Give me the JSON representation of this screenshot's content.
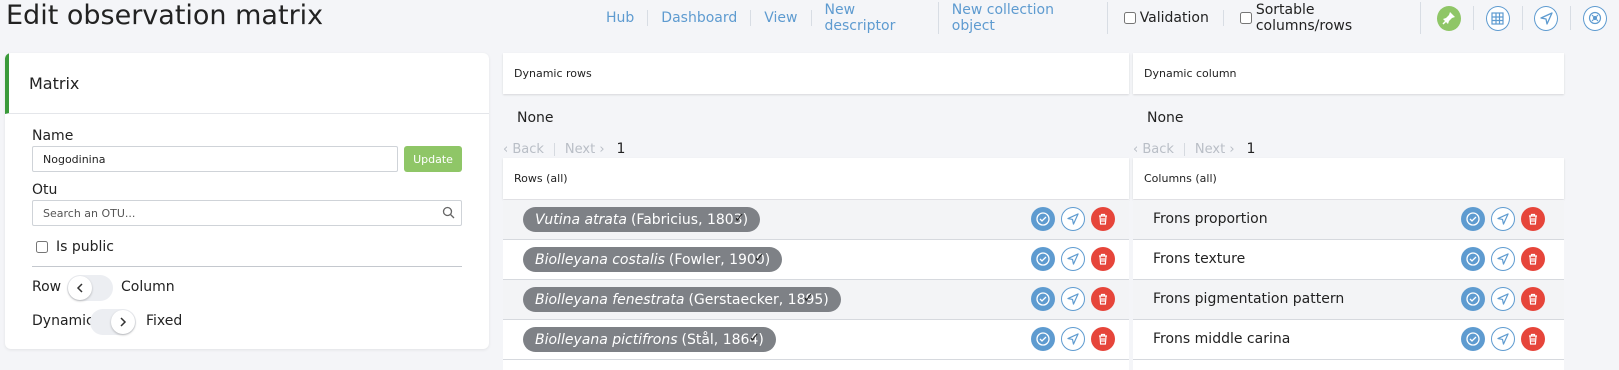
{
  "page_title": "Edit observation matrix",
  "nav": {
    "links": [
      "Hub",
      "Dashboard",
      "View",
      "New descriptor",
      "New collection object"
    ],
    "validation_label": "Validation",
    "sortable_label": "Sortable columns/rows",
    "icons": [
      "pin-icon",
      "grid-icon",
      "navigate-icon",
      "radial-icon"
    ]
  },
  "matrix_panel": {
    "title": "Matrix",
    "name_label": "Name",
    "name_value": "Nogodinina",
    "update_label": "Update",
    "otu_label": "Otu",
    "otu_placeholder": "Search an OTU...",
    "is_public_label": "Is public",
    "row_label": "Row",
    "column_label": "Column",
    "dynamic_label": "Dynamic",
    "fixed_label": "Fixed"
  },
  "dynamic_rows": {
    "title": "Dynamic rows",
    "none": "None",
    "back": "‹ Back",
    "next": "Next ›",
    "page": "1"
  },
  "dynamic_column": {
    "title": "Dynamic column",
    "none": "None",
    "back": "‹ Back",
    "next": "Next ›",
    "page": "1"
  },
  "rows_all": {
    "title": "Rows (all)",
    "items": [
      {
        "name": "Vutina atrata",
        "author": "(Fabricius, 1803)",
        "mark": "✓"
      },
      {
        "name": "Biolleyana costalis",
        "author": "(Fowler, 1900)",
        "mark": "✓"
      },
      {
        "name": "Biolleyana fenestrata",
        "author": "(Gerstaecker, 1895)",
        "mark": "✓"
      },
      {
        "name": "Biolleyana pictifrons",
        "author": "(Stål, 1864)",
        "mark": "✓"
      }
    ]
  },
  "columns_all": {
    "title": "Columns (all)",
    "items": [
      "Frons proportion",
      "Frons texture",
      "Frons pigmentation pattern",
      "Frons middle carina"
    ]
  },
  "colors": {
    "accent_blue": "#5e9bd0",
    "green": "#8fc667",
    "red": "#e6453a",
    "chip_gray": "#7e8186"
  }
}
